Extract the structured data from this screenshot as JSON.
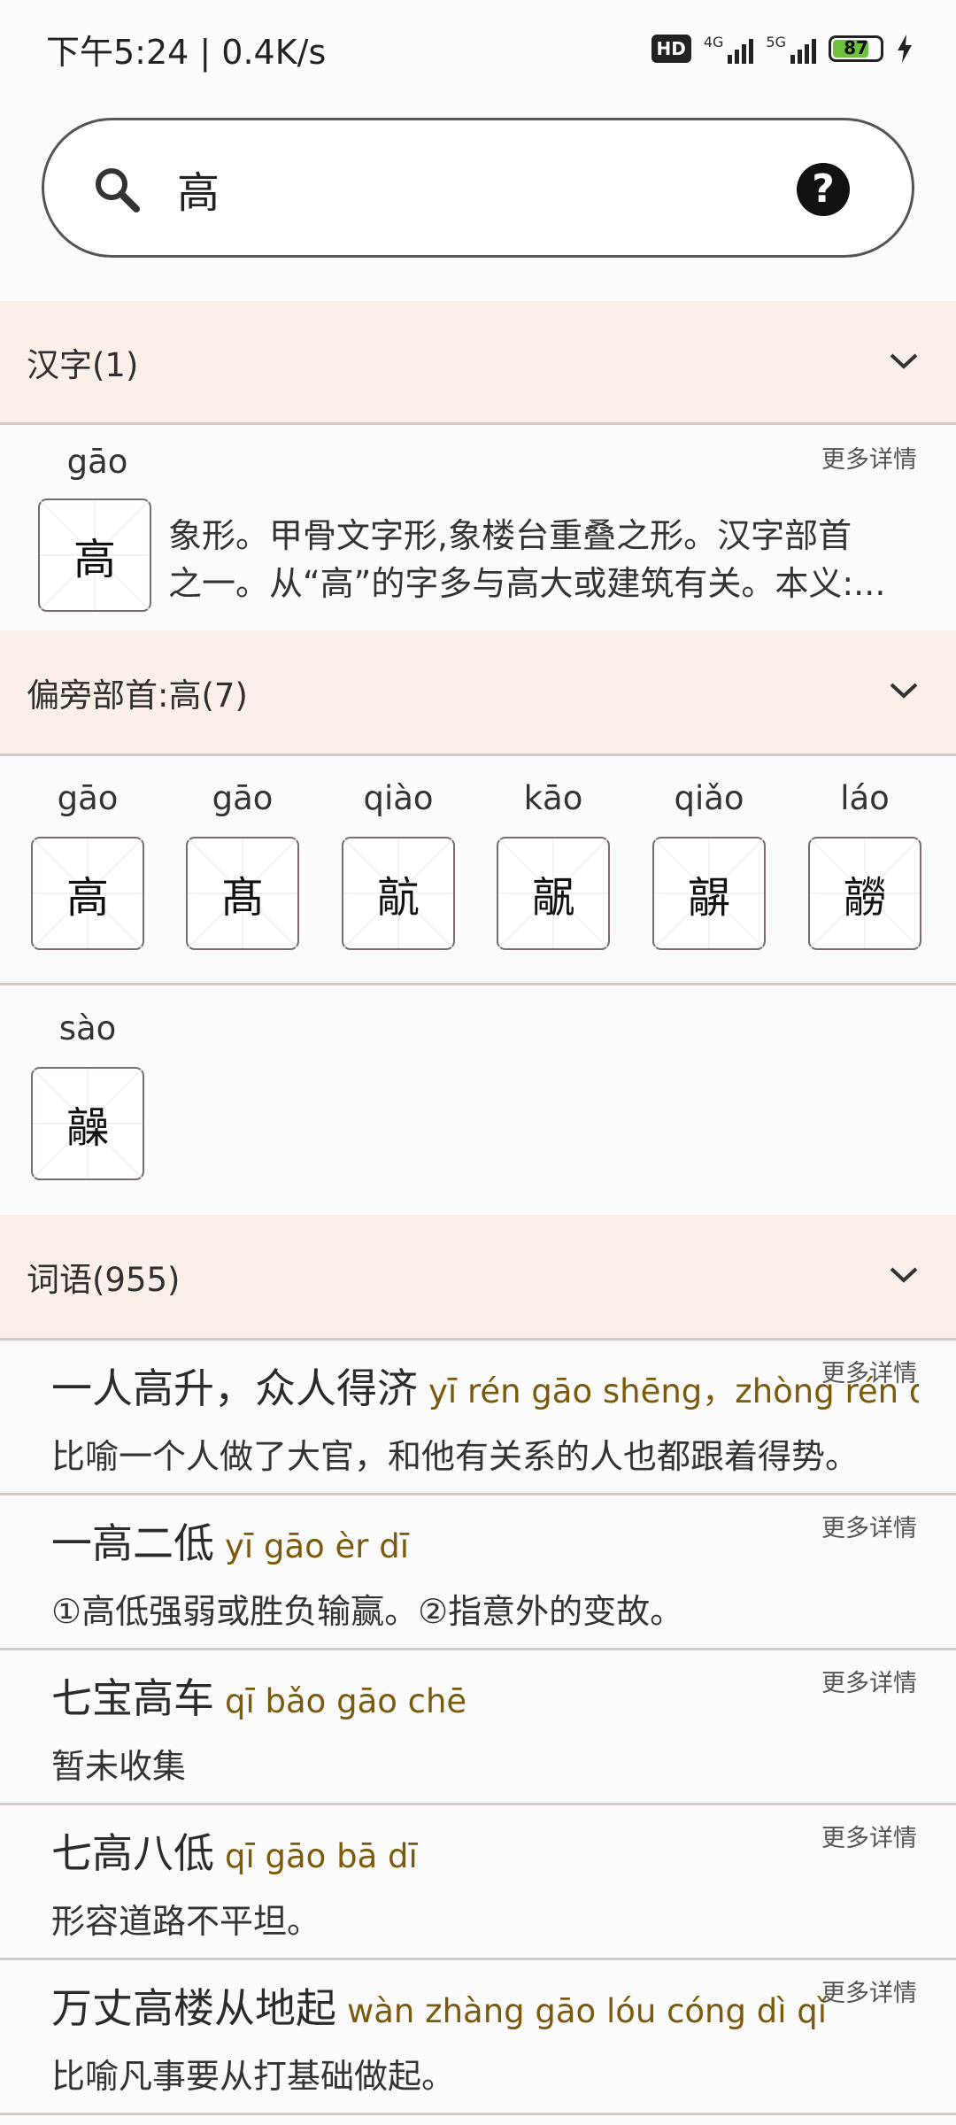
{
  "status_bar": {
    "time": "下午5:24 | 0.4K/s",
    "battery": "87",
    "net1": "4G",
    "net2": "5G",
    "hd": "HD"
  },
  "search": {
    "value": "高"
  },
  "sections": {
    "hanzi": {
      "label": "汉字(1)"
    },
    "radical": {
      "label": "偏旁部首:高(7)"
    },
    "words": {
      "label": "词语(955)"
    }
  },
  "hanzi_entry": {
    "pinyin": "gāo",
    "char": "高",
    "more": "更多详情",
    "desc_line1": "象形。甲骨文字形,象楼台重叠之形。汉字部首",
    "desc_line2": "之一。从“高”的字多与高大或建筑有关。本义:..."
  },
  "radical_chars": [
    {
      "pinyin": "gāo",
      "char": "高"
    },
    {
      "pinyin": "gāo",
      "char": "髙"
    },
    {
      "pinyin": "qiào",
      "char": "髚"
    },
    {
      "pinyin": "kāo",
      "char": "髛"
    },
    {
      "pinyin": "qiǎo",
      "char": "髜"
    },
    {
      "pinyin": "láo",
      "char": "髝"
    },
    {
      "pinyin": "sào",
      "char": "髞"
    }
  ],
  "words": [
    {
      "term": "一人高升，众人得济",
      "pinyin": "yī rén gāo shēng，zhòng rén dé jì",
      "meaning": "比喻一个人做了大官，和他有关系的人也都跟着得势。",
      "more": "更多详情"
    },
    {
      "term": "一高二低",
      "pinyin": "yī gāo èr dī",
      "meaning": "①高低强弱或胜负输赢。②指意外的变故。",
      "more": "更多详情"
    },
    {
      "term": "七宝高车",
      "pinyin": "qī bǎo gāo chē",
      "meaning": "暂未收集",
      "more": "更多详情"
    },
    {
      "term": "七高八低",
      "pinyin": "qī gāo bā dī",
      "meaning": "形容道路不平坦。",
      "more": "更多详情"
    },
    {
      "term": "万丈高楼从地起",
      "pinyin": "wàn zhàng gāo lóu cóng dì qǐ",
      "meaning": "比喻凡事要从打基础做起。",
      "more": "更多详情"
    }
  ]
}
